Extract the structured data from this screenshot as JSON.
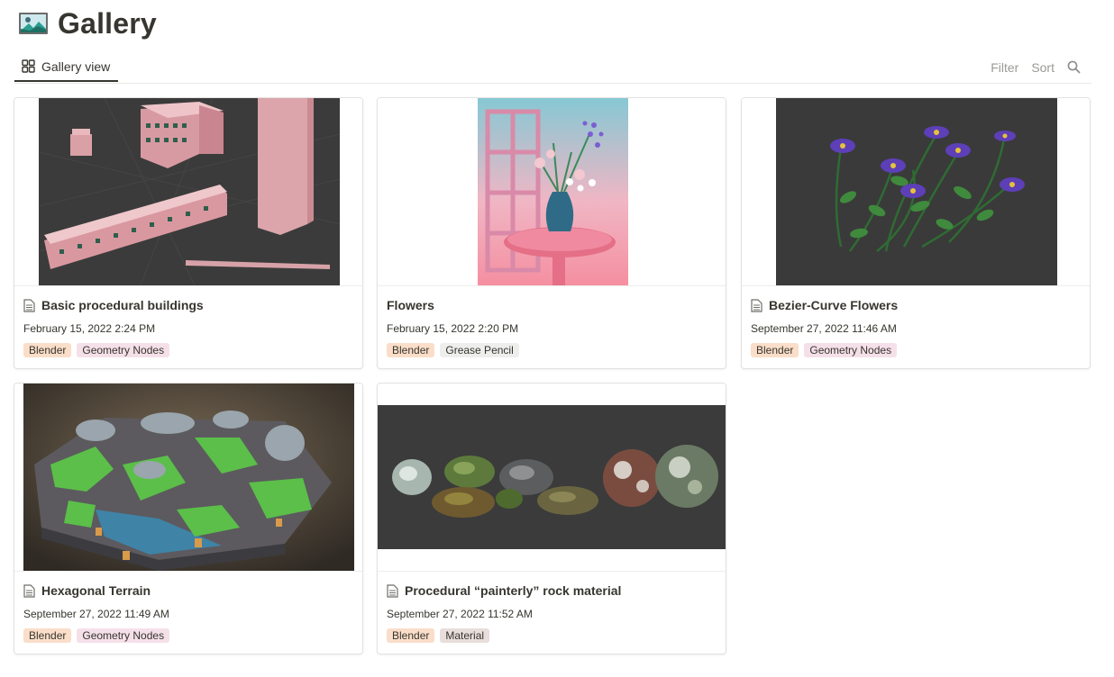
{
  "page": {
    "title": "Gallery",
    "icon": "landscape-picture-icon"
  },
  "view": {
    "tab_label": "Gallery view",
    "filter_label": "Filter",
    "sort_label": "Sort"
  },
  "tag_colors": {
    "Blender": "#fadec9",
    "Geometry Nodes": "#f5e0e9",
    "Grease Pencil": "#eeeeec",
    "Material": "#e8dedb"
  },
  "cards": [
    {
      "title": "Basic procedural buildings",
      "date": "February 15, 2022 2:24 PM",
      "tags": [
        "Blender",
        "Geometry Nodes"
      ],
      "cover": "procedural-buildings-render",
      "has_doc_icon": true
    },
    {
      "title": "Flowers",
      "date": "February 15, 2022 2:20 PM",
      "tags": [
        "Blender",
        "Grease Pencil"
      ],
      "cover": "flowers-vase-illustration",
      "has_doc_icon": false
    },
    {
      "title": "Bezier-Curve Flowers",
      "date": "September 27, 2022 11:46 AM",
      "tags": [
        "Blender",
        "Geometry Nodes"
      ],
      "cover": "purple-flowers-render",
      "has_doc_icon": true
    },
    {
      "title": "Hexagonal Terrain",
      "date": "September 27, 2022 11:49 AM",
      "tags": [
        "Blender",
        "Geometry Nodes"
      ],
      "cover": "hexagonal-terrain-render",
      "has_doc_icon": true
    },
    {
      "title": "Procedural “painterly” rock material",
      "date": "September 27, 2022 11:52 AM",
      "tags": [
        "Blender",
        "Material"
      ],
      "cover": "painterly-rocks-render",
      "has_doc_icon": true
    }
  ]
}
